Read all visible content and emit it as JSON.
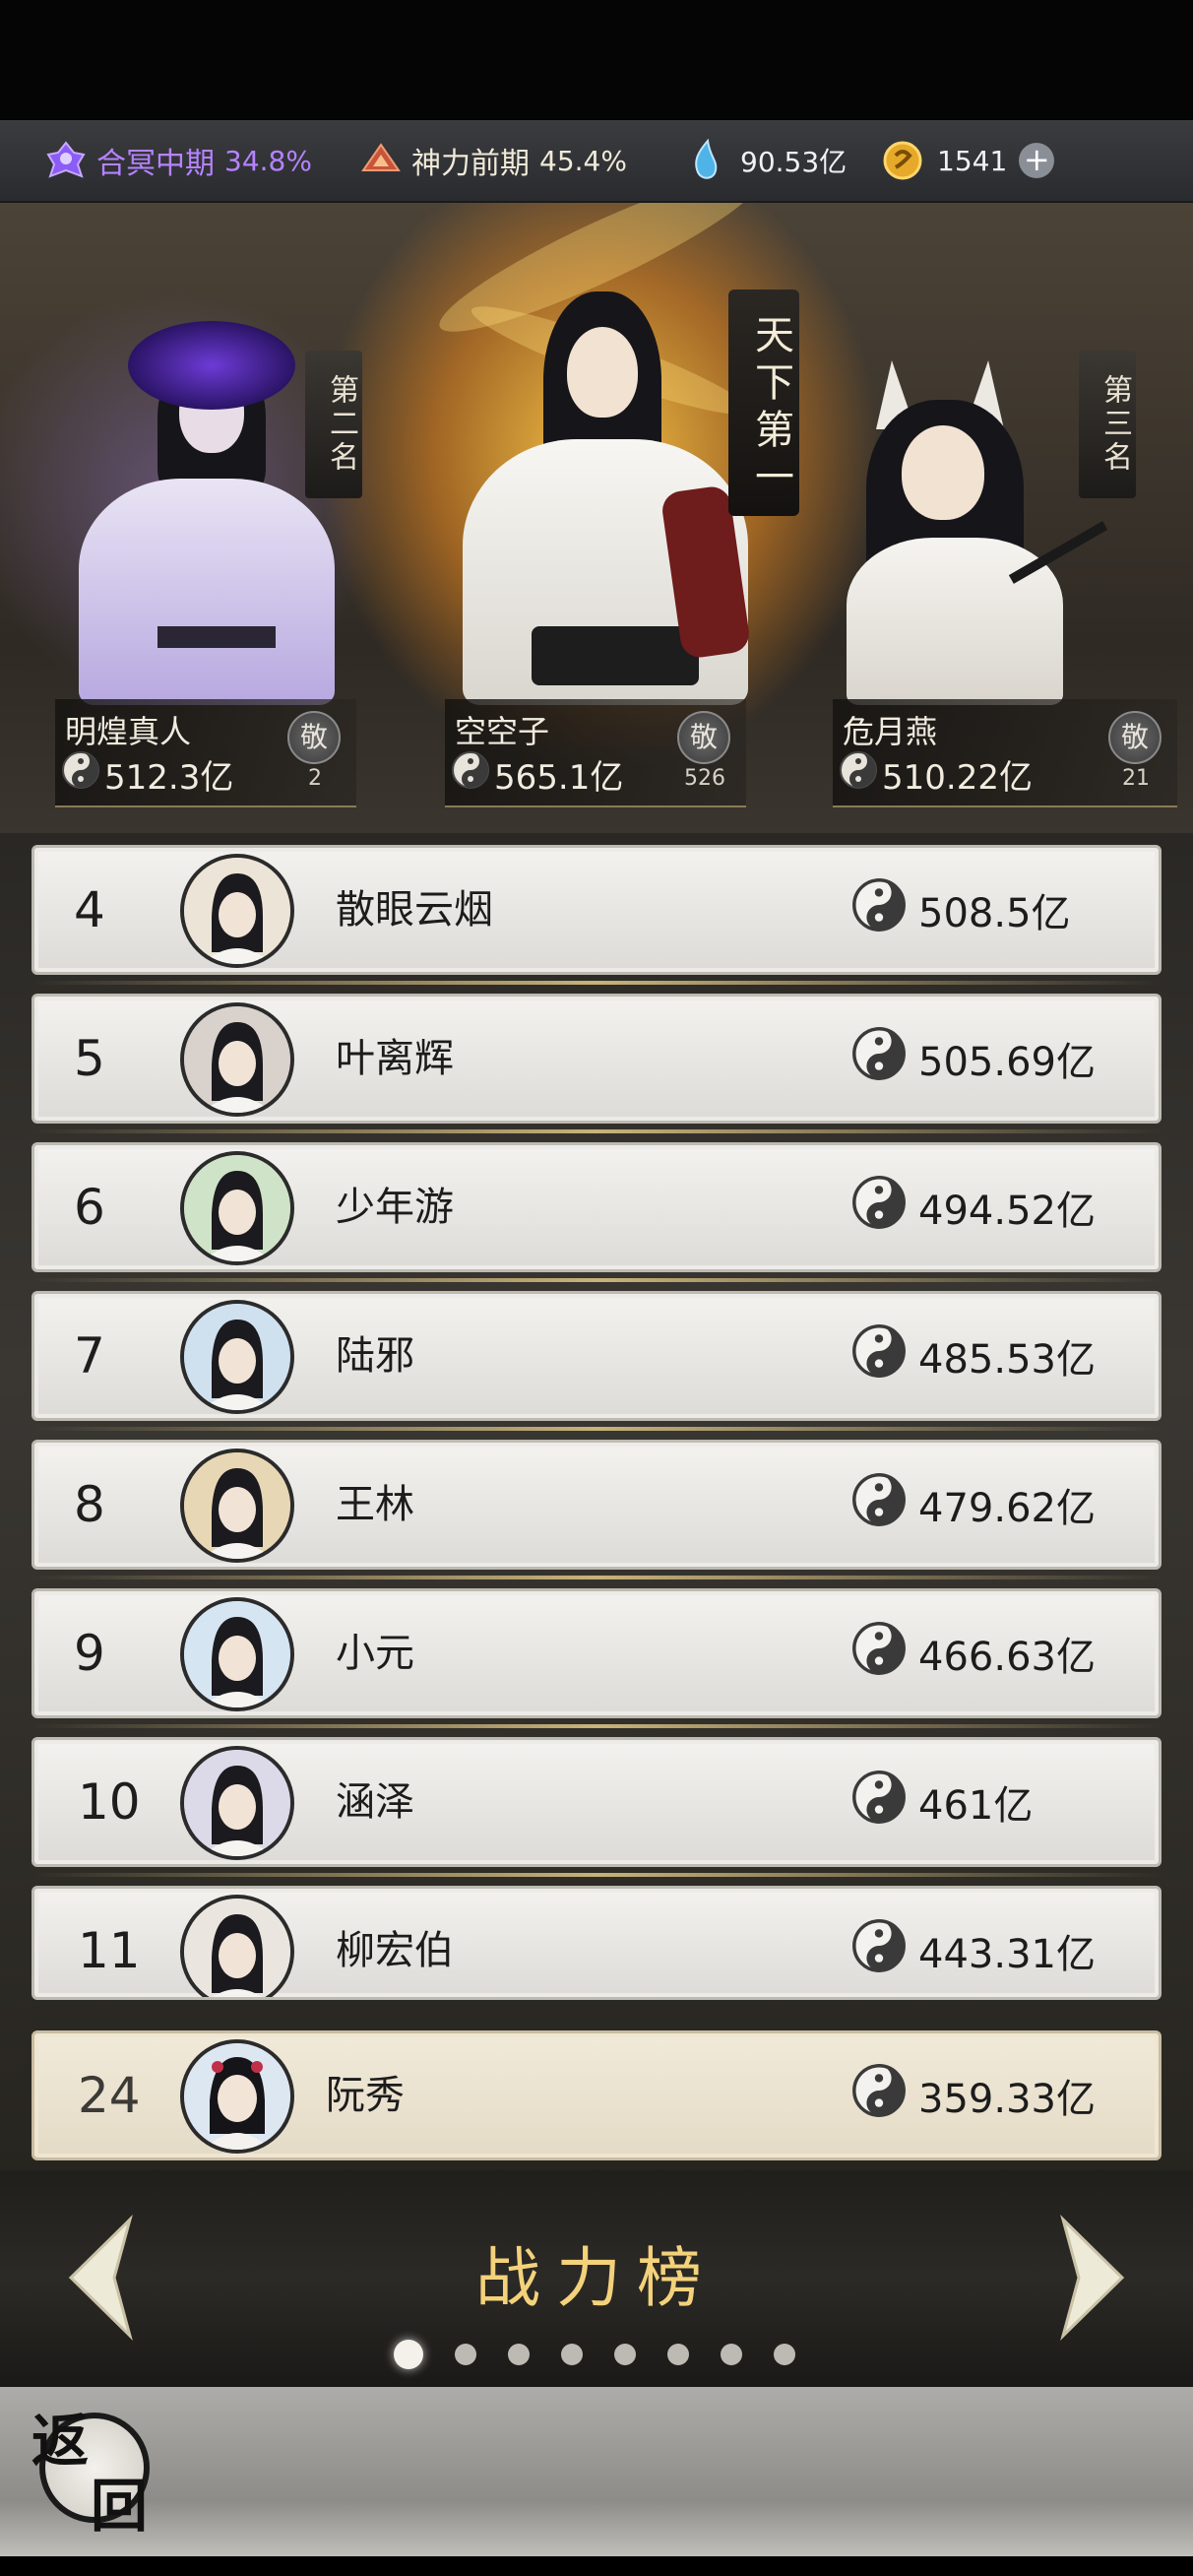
{
  "resources": {
    "realm": {
      "label": "合冥中期",
      "value": "34.8%",
      "color": "#b583ff",
      "icon": "realm-icon"
    },
    "divine": {
      "label": "神力前期",
      "value": "45.4%",
      "color": "#f0ead8",
      "icon": "divine-power-icon"
    },
    "spirit": {
      "value": "90.53亿",
      "icon": "spirit-crystal-icon"
    },
    "coins": {
      "value": "1541",
      "icon": "coin-icon"
    }
  },
  "hero": {
    "first_banner": "天下第一",
    "second_banner": "第二名",
    "third_banner": "第三名",
    "podium": [
      {
        "rank": 2,
        "name": "明煌真人",
        "power": "512.3亿",
        "like_label": "敬",
        "likes": "2"
      },
      {
        "rank": 1,
        "name": "空空子",
        "power": "565.1亿",
        "like_label": "敬",
        "likes": "526"
      },
      {
        "rank": 3,
        "name": "危月燕",
        "power": "510.22亿",
        "like_label": "敬",
        "likes": "21"
      }
    ]
  },
  "ranking": [
    {
      "rank": "4",
      "name": "散眼云烟",
      "power": "508.5亿"
    },
    {
      "rank": "5",
      "name": "叶离辉",
      "power": "505.69亿"
    },
    {
      "rank": "6",
      "name": "少年游",
      "power": "494.52亿"
    },
    {
      "rank": "7",
      "name": "陆邪",
      "power": "485.53亿"
    },
    {
      "rank": "8",
      "name": "王林",
      "power": "479.62亿"
    },
    {
      "rank": "9",
      "name": "小元",
      "power": "466.63亿"
    },
    {
      "rank": "10",
      "name": "涵泽",
      "power": "461亿"
    },
    {
      "rank": "11",
      "name": "柳宏伯",
      "power": "443.31亿"
    }
  ],
  "my_rank": {
    "rank": "24",
    "name": "阮秀",
    "power": "359.33亿"
  },
  "nav": {
    "title": "战力榜",
    "page_count": 8,
    "active_page": 1
  },
  "back": {
    "label_1": "返",
    "label_2": "回"
  }
}
